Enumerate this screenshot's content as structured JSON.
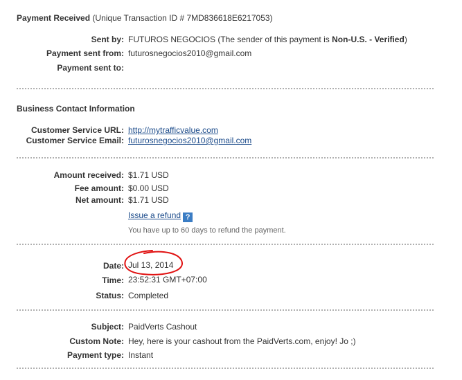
{
  "header": {
    "title": "Payment Received",
    "transaction": "(Unique Transaction ID # 7MD836618E6217053)"
  },
  "sender": {
    "sent_by_label": "Sent by:",
    "sent_by_name": "FUTUROS NEGOCIOS",
    "sent_by_note_pre": "(The sender of this payment is",
    "sent_by_status": "Non-U.S. - Verified",
    "sent_by_note_post": ")",
    "sent_from_label": "Payment sent from:",
    "sent_from_value": "futurosnegocios2010@gmail.com",
    "sent_to_label": "Payment sent to:",
    "sent_to_value": ""
  },
  "business": {
    "heading": "Business Contact Information",
    "url_label": "Customer Service URL:",
    "url_value": "http://mytrafficvalue.com",
    "email_label": "Customer Service Email:",
    "email_value": "futurosnegocios2010@gmail.com"
  },
  "amounts": {
    "received_label": "Amount received:",
    "received_value": "$1.71 USD",
    "fee_label": "Fee amount:",
    "fee_value": "$0.00 USD",
    "net_label": "Net amount:",
    "net_value": "$1.71 USD",
    "refund_link": "Issue a refund",
    "help_glyph": "?",
    "refund_note": "You have up to 60 days to refund the payment."
  },
  "details": {
    "date_label": "Date:",
    "date_value": "Jul 13, 2014",
    "time_label": "Time:",
    "time_value": "23:52:31 GMT+07:00",
    "status_label": "Status:",
    "status_value": "Completed"
  },
  "message": {
    "subject_label": "Subject:",
    "subject_value": "PaidVerts Cashout",
    "note_label": "Custom Note:",
    "note_value": "Hey, here is your cashout from the PaidVerts.com, enjoy! Jo ;)",
    "type_label": "Payment type:",
    "type_value": "Instant"
  },
  "colors": {
    "link": "#1a4a8a",
    "help_icon": "#3b7dc4",
    "annotation": "#e01010"
  },
  "icons": {
    "help": "question-help-icon"
  }
}
